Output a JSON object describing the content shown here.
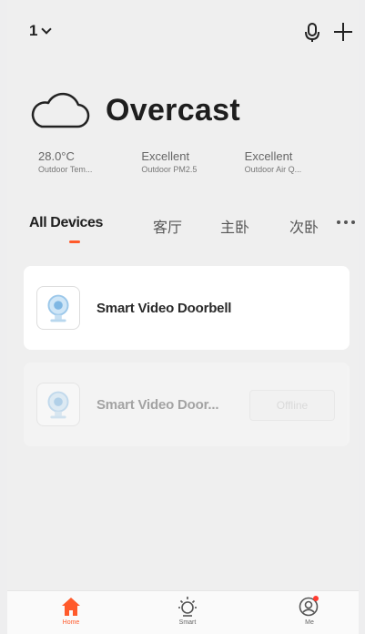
{
  "header": {
    "home_name": "1"
  },
  "weather": {
    "condition": "Overcast"
  },
  "stats": [
    {
      "value": "28.0°C",
      "label": "Outdoor Tem..."
    },
    {
      "value": "Excellent",
      "label": "Outdoor PM2.5"
    },
    {
      "value": "Excellent",
      "label": "Outdoor Air Q..."
    }
  ],
  "tabs": [
    "All Devices",
    "客厅",
    "主卧",
    "次卧"
  ],
  "devices": [
    {
      "name": "Smart Video Doorbell",
      "status": ""
    },
    {
      "name": "Smart Video Door...",
      "status": "Offline"
    }
  ],
  "bottom_nav": [
    {
      "label": "Home"
    },
    {
      "label": "Smart"
    },
    {
      "label": "Me"
    }
  ],
  "colors": {
    "accent": "#ff5a2b",
    "background": "#efefef"
  }
}
